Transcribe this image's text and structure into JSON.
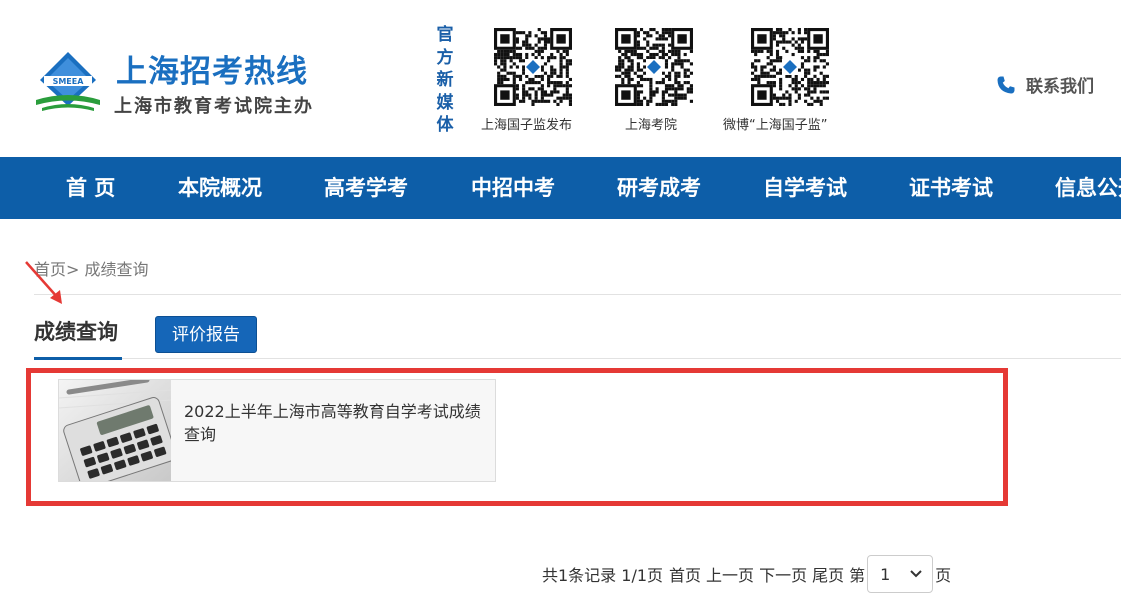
{
  "header": {
    "logo_title": "上海招考热线",
    "logo_subtitle": "上海市教育考试院主办",
    "logo_emblem_text": "SMEEA",
    "media_label": "官方新媒体",
    "qr_codes": [
      {
        "caption": "上海国子监发布"
      },
      {
        "caption": "上海考院"
      },
      {
        "caption": "微博“上海国子监”"
      }
    ],
    "contact_label": "联系我们"
  },
  "nav": {
    "items": [
      "首 页",
      "本院概况",
      "高考学考",
      "中招中考",
      "研考成考",
      "自学考试",
      "证书考试",
      "信息公开"
    ]
  },
  "breadcrumb": {
    "home": "首页",
    "separator": ">",
    "current": "成绩查询"
  },
  "tabs": {
    "active": "成绩查询",
    "button": "评价报告"
  },
  "results": [
    {
      "title": "2022上半年上海市高等教育自学考试成绩查询"
    }
  ],
  "pagination": {
    "summary": "共1条记录 1/1页",
    "first": "首页",
    "prev": "上一页",
    "next": "下一页",
    "last": "尾页",
    "page_prefix": "第",
    "page_value": "1",
    "page_suffix": "页"
  },
  "colors": {
    "brand_blue": "#0d5ea8",
    "button_blue": "#1566b8",
    "highlight_red": "#e53935",
    "logo_green": "#2a9d3c"
  }
}
